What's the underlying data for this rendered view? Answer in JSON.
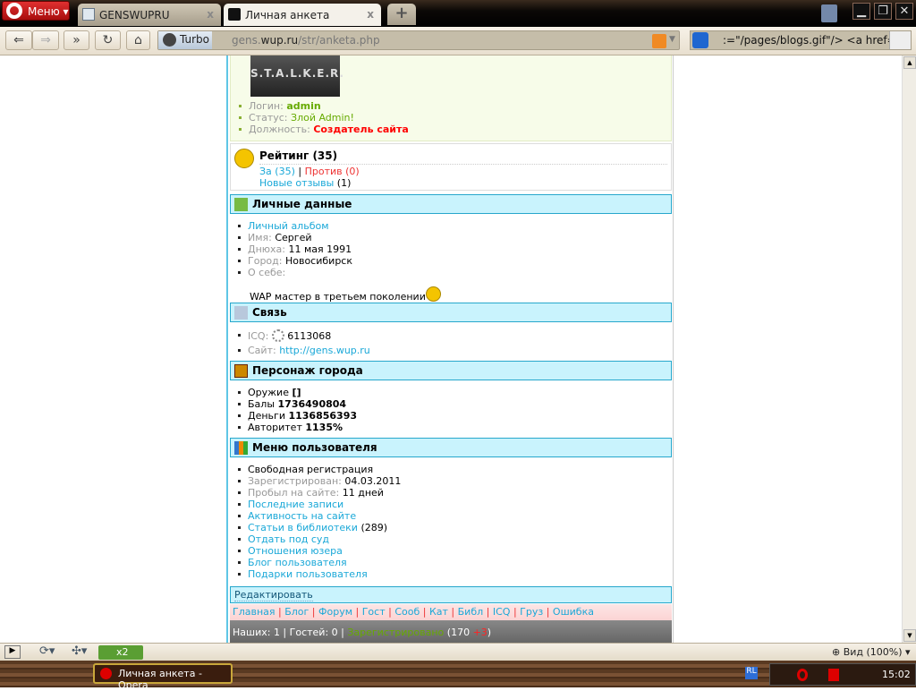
{
  "browser": {
    "menu_label": "Меню",
    "tabs": [
      {
        "title": "GENSWUPRU"
      },
      {
        "title": "Личная анкета"
      }
    ],
    "turbo_label": "Turbo",
    "url_pre": "gens.",
    "url_host": "wup.ru",
    "url_path": "/str/anketa.php",
    "search_value": ":=\"/pages/blogs.gif\"/> <a href=\"../bl"
  },
  "profile": {
    "avatar_text": "S.T.A.L.K.E.R.",
    "login_label": "Логин:",
    "login": "admin",
    "status_label": "Статус:",
    "status": "Злой Admin!",
    "position_label": "Должность:",
    "position": "Создатель сайта"
  },
  "rating": {
    "title": "Рейтинг (35)",
    "for": "За (35)",
    "sep": "|",
    "against": "Против (0)",
    "reviews": "Новые отзывы",
    "reviews_count": "(1)"
  },
  "personal": {
    "title": "Личные данные",
    "album": "Личный альбом",
    "name_label": "Имя:",
    "name": "Сергей",
    "bday_label": "Днюха:",
    "bday": "11 мая 1991",
    "city_label": "Город:",
    "city": "Новосибирск",
    "about_label": "О себе:",
    "about": "WAP мастер в третьем поколении"
  },
  "contact": {
    "title": "Связь",
    "icq_label": "ICQ:",
    "icq": "6113068",
    "site_label": "Сайт:",
    "site": "http://gens.wup.ru"
  },
  "character": {
    "title": "Персонаж города",
    "weapon_label": "Оружие",
    "weapon": "[]",
    "points_label": "Балы",
    "points": "1736490804",
    "money_label": "Деньги",
    "money": "1136856393",
    "auth_label": "Авторитет",
    "auth": "1135%"
  },
  "user_menu": {
    "title": "Меню пользователя",
    "free_reg": "Свободная регистрация",
    "reg_label": "Зарегистрирован:",
    "reg": "04.03.2011",
    "time_label": "Пробыл на сайте:",
    "time": "11 дней",
    "links": [
      "Последние записи",
      "Активность на сайте",
      "Статьи в библиотеки",
      "Отдать под суд",
      "Отношения юзера",
      "Блог пользователя",
      "Подарки пользователя"
    ],
    "articles_count": "(289)"
  },
  "edit_label": "Редактировать",
  "nav": [
    "Главная",
    "Блог",
    "Форум",
    "Гост",
    "Сооб",
    "Кат",
    "Библ",
    "ICQ",
    "Груз",
    "Ошибка"
  ],
  "footer": {
    "ours": "Наших: 1",
    "guests": "Гостей: 0",
    "registered": "Зарегистрировано",
    "count": "(170",
    "plus": "+3",
    "close": ")"
  },
  "statusbar": {
    "speed": "x2",
    "zoom": "Вид (100%)"
  },
  "taskbar": {
    "window": "Личная анкета - Opera",
    "lang": "RL",
    "clock": "15:02"
  },
  "colors": {
    "accent": "#1aa8d8",
    "header_bg": "#c9f3fd",
    "green": "#66aa00",
    "red": "#ff0000"
  }
}
